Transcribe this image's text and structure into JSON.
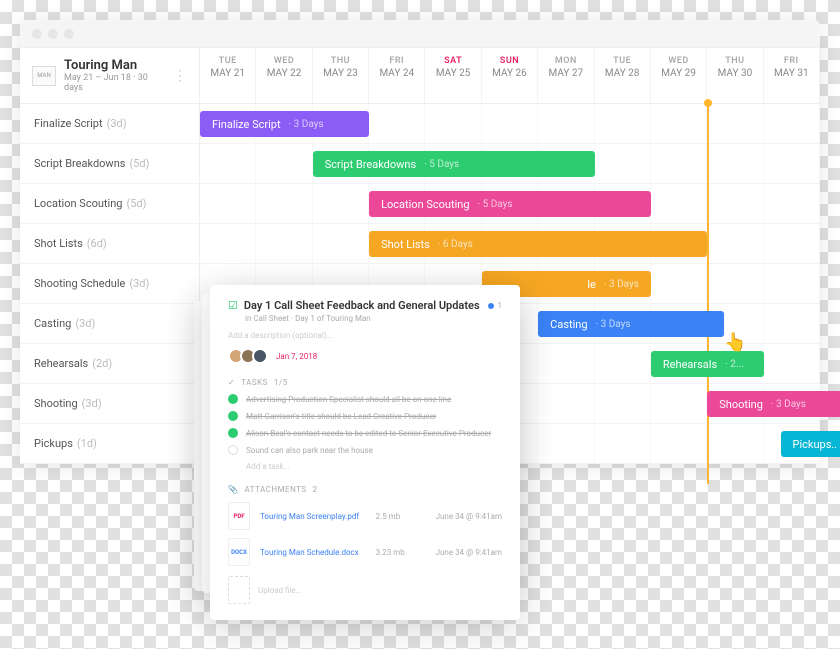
{
  "project": {
    "title": "Touring Man",
    "subtitle": "May 21 – Jun 18  ·  30 days",
    "logo": "MAN"
  },
  "dates": [
    {
      "day": "TUE",
      "num": "MAY 21",
      "weekend": false
    },
    {
      "day": "WED",
      "num": "MAY 22",
      "weekend": false
    },
    {
      "day": "THU",
      "num": "MAY 23",
      "weekend": false
    },
    {
      "day": "FRI",
      "num": "MAY 24",
      "weekend": false
    },
    {
      "day": "SAT",
      "num": "MAY 25",
      "weekend": true
    },
    {
      "day": "SUN",
      "num": "MAY 26",
      "weekend": true
    },
    {
      "day": "MON",
      "num": "MAY 27",
      "weekend": false
    },
    {
      "day": "TUE",
      "num": "MAY 28",
      "weekend": false
    },
    {
      "day": "WED",
      "num": "MAY 29",
      "weekend": false
    },
    {
      "day": "THU",
      "num": "MAY 30",
      "weekend": false
    },
    {
      "day": "FRI",
      "num": "MAY 31",
      "weekend": false
    }
  ],
  "today_index": 9,
  "rows": [
    {
      "name": "Finalize Script",
      "dur": "(3d)",
      "bar": {
        "start": 0,
        "span": 3,
        "color": "#8b5cf6",
        "label": "Finalize Script",
        "dur": "3 Days"
      }
    },
    {
      "name": "Script Breakdowns",
      "dur": "(5d)",
      "bar": {
        "start": 2,
        "span": 5,
        "color": "#2ecc71",
        "label": "Script Breakdowns",
        "dur": "5 Days"
      }
    },
    {
      "name": "Location Scouting",
      "dur": "(5d)",
      "bar": {
        "start": 3,
        "span": 5,
        "color": "#ec4899",
        "label": "Location Scouting",
        "dur": "5 Days"
      }
    },
    {
      "name": "Shot Lists",
      "dur": "(6d)",
      "bar": {
        "start": 3,
        "span": 6,
        "color": "#f5a623",
        "label": "Shot Lists",
        "dur": "6 Days"
      }
    },
    {
      "name": "Shooting Schedule",
      "dur": "(3d)",
      "bar": {
        "start": 5,
        "span": 3,
        "color": "#f5a623",
        "label": "le",
        "dur": "3 Days",
        "behind": true
      }
    },
    {
      "name": "Casting",
      "dur": "(3d)",
      "bar": {
        "start": 6,
        "span": 3.3,
        "color": "#3b82f6",
        "label": "Casting",
        "dur": "3 Days"
      }
    },
    {
      "name": "Rehearsals",
      "dur": "(2d)",
      "bar": {
        "start": 8,
        "span": 2,
        "color": "#2ecc71",
        "label": "Rehearsals",
        "dur": "2..."
      }
    },
    {
      "name": "Shooting",
      "dur": "(3d)",
      "bar": {
        "start": 9,
        "span": 2.5,
        "color": "#ec4899",
        "label": "Shooting",
        "dur": "3 Days"
      }
    },
    {
      "name": "Pickups",
      "dur": "(1d)",
      "bar": {
        "start": 10.3,
        "span": 1.2,
        "color": "#06b6d4",
        "label": "Pickups..",
        "dur": ""
      }
    }
  ],
  "card": {
    "title": "Day 1 Call Sheet Feedback and General Updates",
    "status_count": "1",
    "breadcrumb": "in Call Sheet  ·  Day 1 of Touring Man",
    "desc_placeholder": "Add a description (optional)...",
    "date": "Jan 7, 2018",
    "tasks_label": "TASKS",
    "tasks_count": "1/5",
    "tasks": [
      {
        "done": true,
        "text": "Advertising Production Specialist should all be on one line"
      },
      {
        "done": true,
        "text": "Matt Garrison's title should be Lead Creative Producer"
      },
      {
        "done": true,
        "text": "Alison Beal's contact needs to be edited to Senior Executive Producer"
      },
      {
        "done": false,
        "text": "Sound can also park near the house"
      }
    ],
    "add_task": "Add a task...",
    "attach_label": "ATTACHMENTS",
    "attach_count": "2",
    "attachments": [
      {
        "type": "PDF",
        "name": "Touring Man Screenplay.pdf",
        "size": "2.5 mb",
        "date": "June 34 @ 9:41am"
      },
      {
        "type": "DOCX",
        "name": "Touring Man Schedule.docx",
        "size": "3.23 mb",
        "date": "June 34 @ 9:41am"
      }
    ],
    "upload": "Upload file..."
  }
}
